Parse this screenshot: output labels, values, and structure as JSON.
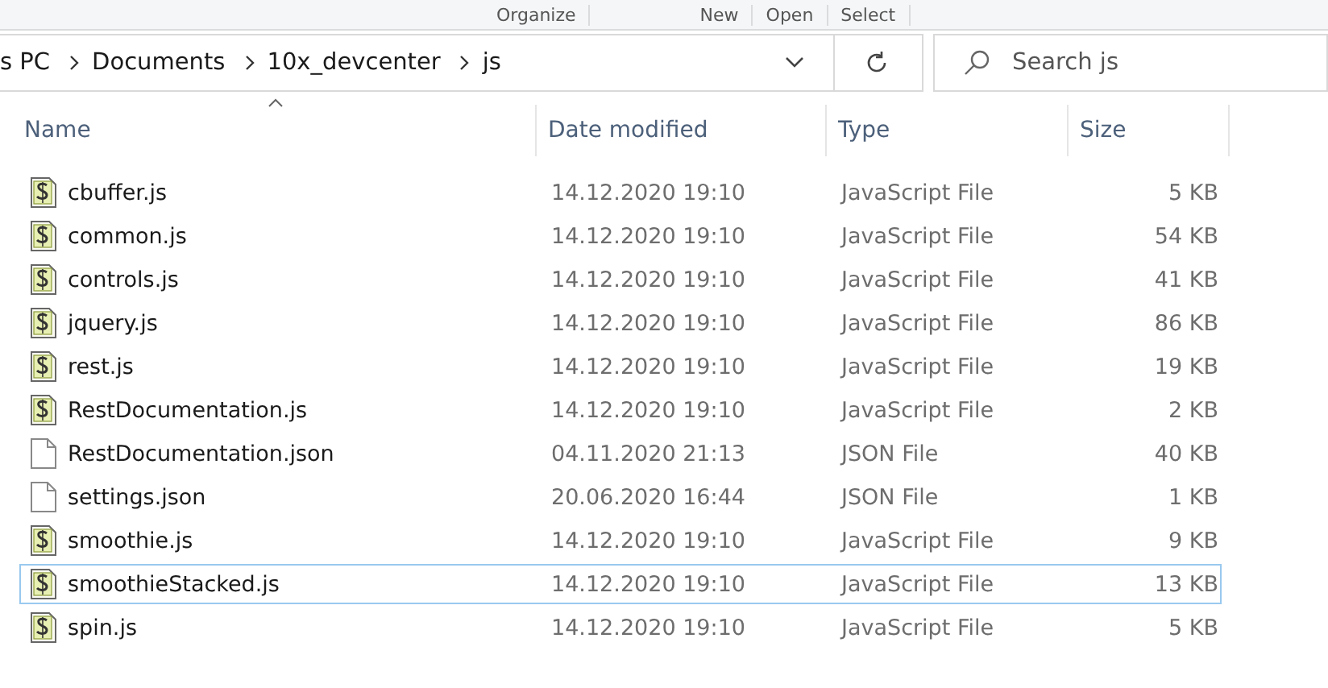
{
  "ribbon_groups": [
    "Organize",
    "New",
    "Open",
    "Select"
  ],
  "breadcrumb": [
    "s PC",
    "Documents",
    "10x_devcenter",
    "js"
  ],
  "search": {
    "placeholder": "Search js"
  },
  "columns": [
    {
      "label": "Name",
      "sorted": true
    },
    {
      "label": "Date modified",
      "sorted": false
    },
    {
      "label": "Type",
      "sorted": false
    },
    {
      "label": "Size",
      "sorted": false
    }
  ],
  "files": [
    {
      "name": "cbuffer.js",
      "kind": "script",
      "date": "14.12.2020 19:10",
      "type": "JavaScript File",
      "size": "5 KB",
      "focused": false
    },
    {
      "name": "common.js",
      "kind": "script",
      "date": "14.12.2020 19:10",
      "type": "JavaScript File",
      "size": "54 KB",
      "focused": false
    },
    {
      "name": "controls.js",
      "kind": "script",
      "date": "14.12.2020 19:10",
      "type": "JavaScript File",
      "size": "41 KB",
      "focused": false
    },
    {
      "name": "jquery.js",
      "kind": "script",
      "date": "14.12.2020 19:10",
      "type": "JavaScript File",
      "size": "86 KB",
      "focused": false
    },
    {
      "name": "rest.js",
      "kind": "script",
      "date": "14.12.2020 19:10",
      "type": "JavaScript File",
      "size": "19 KB",
      "focused": false
    },
    {
      "name": "RestDocumentation.js",
      "kind": "script",
      "date": "14.12.2020 19:10",
      "type": "JavaScript File",
      "size": "2 KB",
      "focused": false
    },
    {
      "name": "RestDocumentation.json",
      "kind": "plain",
      "date": "04.11.2020 21:13",
      "type": "JSON File",
      "size": "40 KB",
      "focused": false
    },
    {
      "name": "settings.json",
      "kind": "plain",
      "date": "20.06.2020 16:44",
      "type": "JSON File",
      "size": "1 KB",
      "focused": false
    },
    {
      "name": "smoothie.js",
      "kind": "script",
      "date": "14.12.2020 19:10",
      "type": "JavaScript File",
      "size": "9 KB",
      "focused": false
    },
    {
      "name": "smoothieStacked.js",
      "kind": "script",
      "date": "14.12.2020 19:10",
      "type": "JavaScript File",
      "size": "13 KB",
      "focused": true
    },
    {
      "name": "spin.js",
      "kind": "script",
      "date": "14.12.2020 19:10",
      "type": "JavaScript File",
      "size": "5 KB",
      "focused": false
    }
  ]
}
